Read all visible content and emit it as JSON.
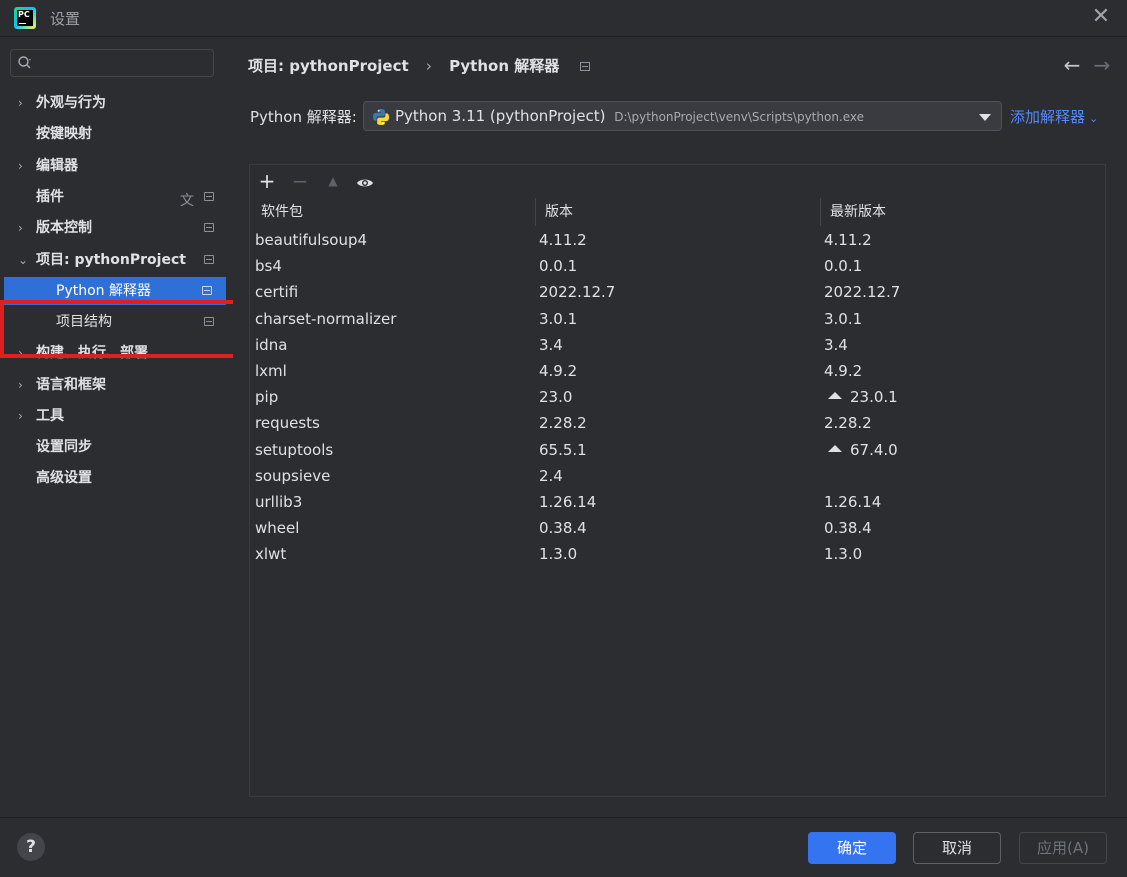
{
  "window": {
    "title": "设置",
    "close_glyph": "✕"
  },
  "search": {
    "placeholder": "",
    "value": ""
  },
  "sidebar": {
    "items": [
      {
        "label": "外观与行为",
        "expandable": true
      },
      {
        "label": "按键映射",
        "expandable": false
      },
      {
        "label": "编辑器",
        "expandable": true
      },
      {
        "label": "插件",
        "expandable": false,
        "badge": true,
        "translate_icon": true
      },
      {
        "label": "版本控制",
        "expandable": true,
        "badge": true
      },
      {
        "label": "项目: pythonProject",
        "expandable": true,
        "expanded": true,
        "badge": true
      },
      {
        "label": "Python 解释器",
        "child": true,
        "selected": true,
        "badge": true
      },
      {
        "label": "项目结构",
        "child": true,
        "badge": true
      },
      {
        "label": "构建、执行、部署",
        "expandable": true
      },
      {
        "label": "语言和框架",
        "expandable": true
      },
      {
        "label": "工具",
        "expandable": true
      },
      {
        "label": "设置同步",
        "expandable": false
      },
      {
        "label": "高级设置",
        "expandable": false
      }
    ]
  },
  "breadcrumb": {
    "project": "项目: pythonProject",
    "separator": "›",
    "page": "Python 解释器"
  },
  "nav_arrows": {
    "back": "←",
    "forward": "→"
  },
  "interpreter": {
    "label": "Python 解释器:",
    "selected_name": "Python 3.11 (pythonProject)",
    "selected_path": "D:\\pythonProject\\venv\\Scripts\\python.exe",
    "add_label": "添加解释器",
    "add_chevron": "⌄"
  },
  "toolbar": {
    "add": "+",
    "remove": "−",
    "upgrade": "▲",
    "show": "👁"
  },
  "table": {
    "headers": [
      "软件包",
      "版本",
      "最新版本"
    ],
    "rows": [
      {
        "package": "beautifulsoup4",
        "version": "4.11.2",
        "latest": "4.11.2",
        "upgrade": false
      },
      {
        "package": "bs4",
        "version": "0.0.1",
        "latest": "0.0.1",
        "upgrade": false
      },
      {
        "package": "certifi",
        "version": "2022.12.7",
        "latest": "2022.12.7",
        "upgrade": false
      },
      {
        "package": "charset-normalizer",
        "version": "3.0.1",
        "latest": "3.0.1",
        "upgrade": false
      },
      {
        "package": "idna",
        "version": "3.4",
        "latest": "3.4",
        "upgrade": false
      },
      {
        "package": "lxml",
        "version": "4.9.2",
        "latest": "4.9.2",
        "upgrade": false
      },
      {
        "package": "pip",
        "version": "23.0",
        "latest": "23.0.1",
        "upgrade": true
      },
      {
        "package": "requests",
        "version": "2.28.2",
        "latest": "2.28.2",
        "upgrade": false
      },
      {
        "package": "setuptools",
        "version": "65.5.1",
        "latest": "67.4.0",
        "upgrade": true
      },
      {
        "package": "soupsieve",
        "version": "2.4",
        "latest": "",
        "upgrade": false
      },
      {
        "package": "urllib3",
        "version": "1.26.14",
        "latest": "1.26.14",
        "upgrade": false
      },
      {
        "package": "wheel",
        "version": "0.38.4",
        "latest": "0.38.4",
        "upgrade": false
      },
      {
        "package": "xlwt",
        "version": "1.3.0",
        "latest": "1.3.0",
        "upgrade": false
      }
    ]
  },
  "footer": {
    "help": "?",
    "ok": "确定",
    "cancel": "取消",
    "apply": "应用(A)"
  },
  "colors": {
    "accent": "#3574f0",
    "selection": "#2e6fd8",
    "highlight_box": "#e02020",
    "link": "#548af7"
  }
}
